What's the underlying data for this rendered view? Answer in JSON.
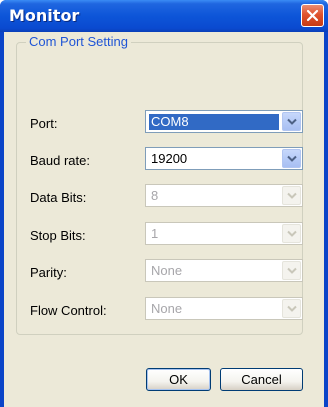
{
  "window": {
    "title": "Monitor"
  },
  "group": {
    "legend": "Com Port Setting"
  },
  "fields": {
    "port": {
      "label": "Port:",
      "value": "COM8"
    },
    "baud_rate": {
      "label": "Baud rate:",
      "value": "19200"
    },
    "data_bits": {
      "label": "Data Bits:",
      "value": "8"
    },
    "stop_bits": {
      "label": "Stop Bits:",
      "value": "1"
    },
    "parity": {
      "label": "Parity:",
      "value": "None"
    },
    "flow_control": {
      "label": "Flow Control:",
      "value": "None"
    }
  },
  "buttons": {
    "ok": "OK",
    "cancel": "Cancel"
  },
  "colors": {
    "title_bar": "#0a44c8",
    "selection": "#316ac5",
    "legend_text": "#1f55d6",
    "dialog_bg": "#ece9d8"
  },
  "icons": {
    "close": "close-icon",
    "dropdown": "chevron-down-icon"
  }
}
